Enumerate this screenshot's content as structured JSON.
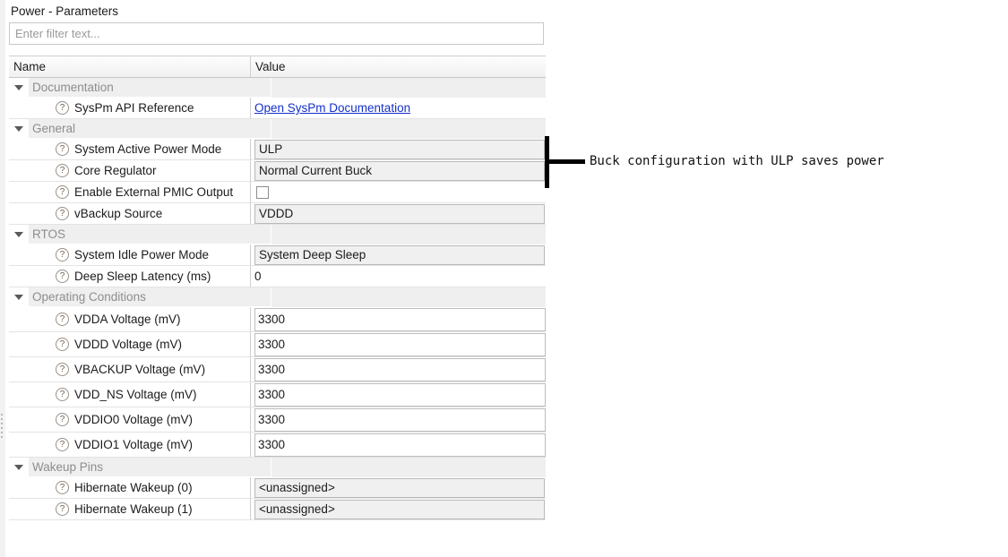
{
  "panel": {
    "title": "Power - Parameters",
    "filter": {
      "value": "",
      "placeholder": "Enter filter text..."
    },
    "columns": {
      "name": "Name",
      "value": "Value"
    }
  },
  "groups": [
    {
      "label": "Documentation",
      "rows": [
        {
          "label": "SysPm API Reference",
          "value": "Open SysPm Documentation",
          "kind": "link"
        }
      ]
    },
    {
      "label": "General",
      "rows": [
        {
          "label": "System Active Power Mode",
          "value": "ULP",
          "kind": "combo"
        },
        {
          "label": "Core Regulator",
          "value": "Normal Current Buck",
          "kind": "combo"
        },
        {
          "label": "Enable External PMIC Output",
          "value": "",
          "kind": "checkbox",
          "checked": false
        },
        {
          "label": "vBackup Source",
          "value": "VDDD",
          "kind": "combo"
        }
      ]
    },
    {
      "label": "RTOS",
      "rows": [
        {
          "label": "System Idle Power Mode",
          "value": "System Deep Sleep",
          "kind": "combo"
        },
        {
          "label": "Deep Sleep Latency (ms)",
          "value": "0",
          "kind": "plain"
        }
      ]
    },
    {
      "label": "Operating Conditions",
      "rows": [
        {
          "label": "VDDA Voltage (mV)",
          "value": "3300",
          "kind": "text"
        },
        {
          "label": "VDDD Voltage (mV)",
          "value": "3300",
          "kind": "text"
        },
        {
          "label": "VBACKUP Voltage (mV)",
          "value": "3300",
          "kind": "text"
        },
        {
          "label": "VDD_NS Voltage (mV)",
          "value": "3300",
          "kind": "text"
        },
        {
          "label": "VDDIO0 Voltage (mV)",
          "value": "3300",
          "kind": "text"
        },
        {
          "label": "VDDIO1 Voltage (mV)",
          "value": "3300",
          "kind": "text"
        }
      ]
    },
    {
      "label": "Wakeup Pins",
      "rows": [
        {
          "label": "Hibernate Wakeup (0)",
          "value": "<unassigned>",
          "kind": "combo"
        },
        {
          "label": "Hibernate Wakeup (1)",
          "value": "<unassigned>",
          "kind": "combo"
        }
      ]
    }
  ],
  "annotation": {
    "text": "Buck configuration with ULP saves power"
  },
  "icons": {
    "help": "?",
    "expand_arrow": "triangle-down"
  },
  "colors": {
    "link": "#1430c8",
    "group_label": "#8d8d8d",
    "annotation": "#111111"
  }
}
